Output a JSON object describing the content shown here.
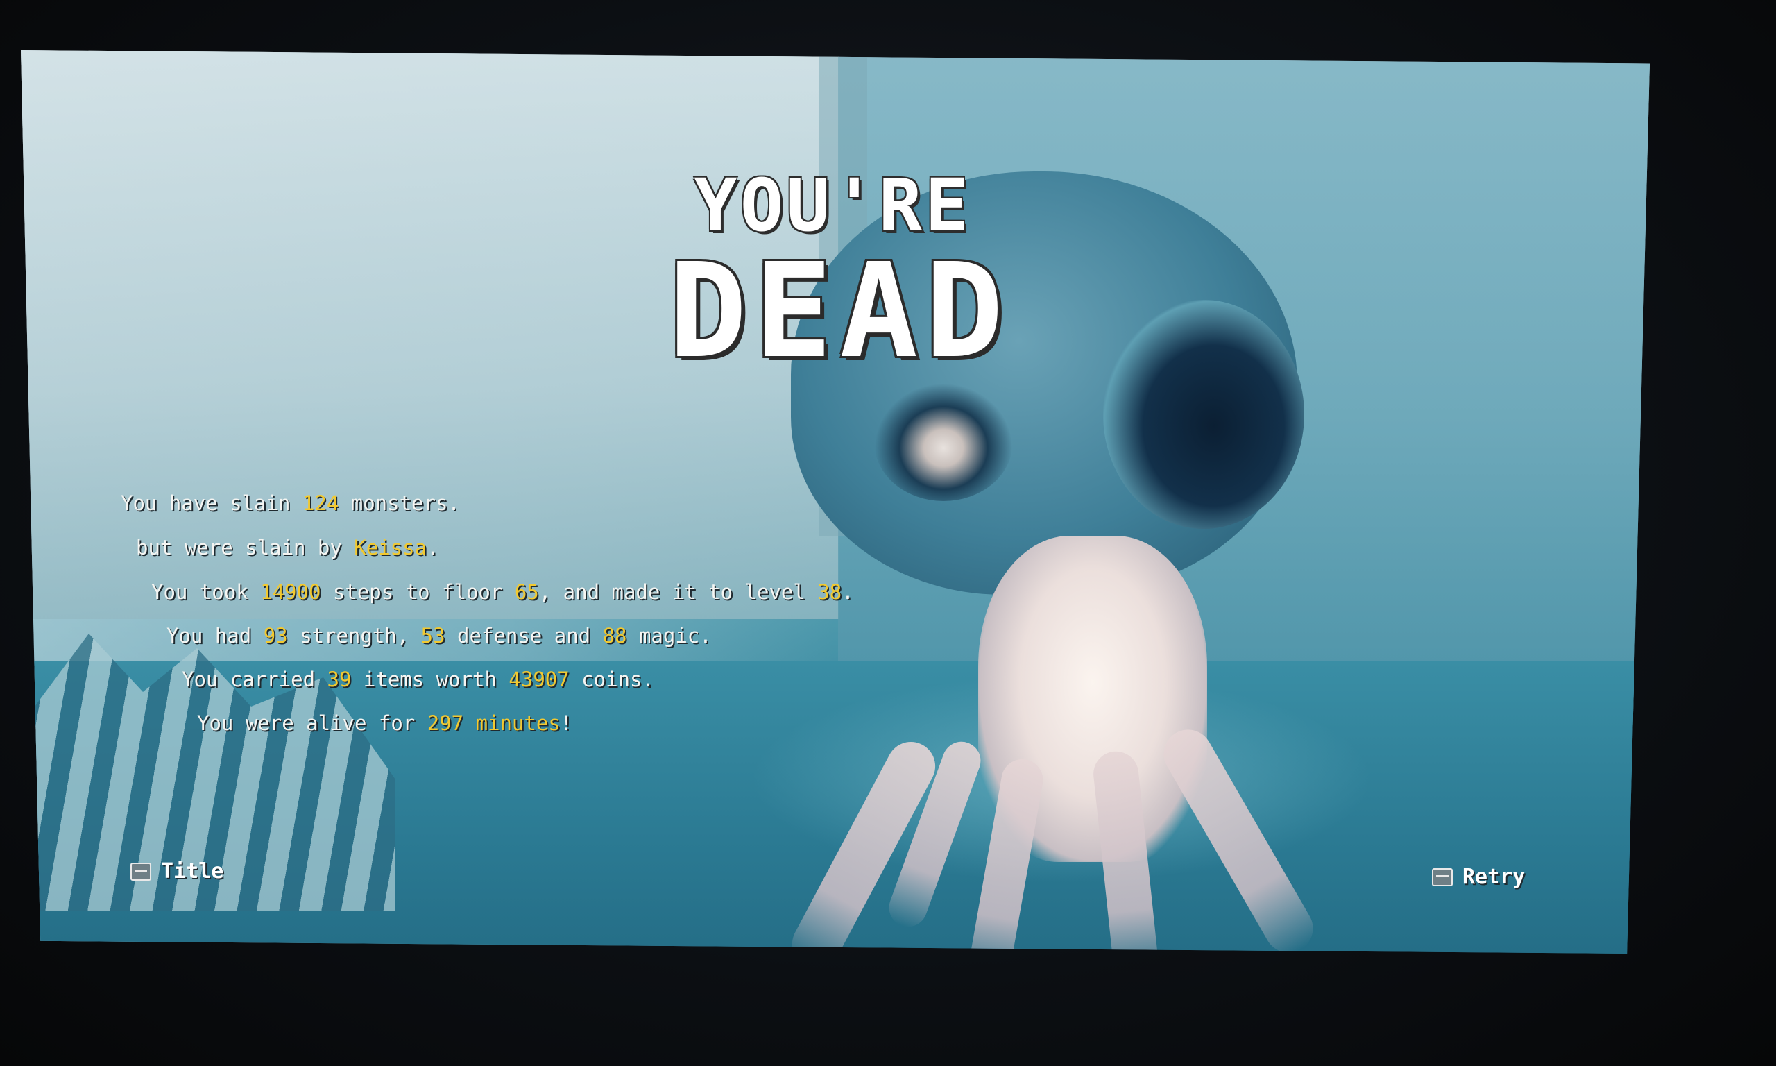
{
  "header": {
    "title_top": "YOU'RE",
    "title_main": "DEAD"
  },
  "stats": [
    [
      {
        "t": "You have slain ",
        "h": false
      },
      {
        "t": "124",
        "h": true
      },
      {
        "t": " monsters.",
        "h": false
      }
    ],
    [
      {
        "t": "but were slain by ",
        "h": false
      },
      {
        "t": "Keissa",
        "h": true
      },
      {
        "t": ".",
        "h": false
      }
    ],
    [
      {
        "t": "You took ",
        "h": false
      },
      {
        "t": "14900",
        "h": true
      },
      {
        "t": " steps to floor ",
        "h": false
      },
      {
        "t": "65",
        "h": true
      },
      {
        "t": ", and made it to level ",
        "h": false
      },
      {
        "t": "38",
        "h": true
      },
      {
        "t": ".",
        "h": false
      }
    ],
    [
      {
        "t": "You had ",
        "h": false
      },
      {
        "t": "93",
        "h": true
      },
      {
        "t": " strength, ",
        "h": false
      },
      {
        "t": "53",
        "h": true
      },
      {
        "t": " defense and ",
        "h": false
      },
      {
        "t": "88",
        "h": true
      },
      {
        "t": " magic.",
        "h": false
      }
    ],
    [
      {
        "t": "You carried ",
        "h": false
      },
      {
        "t": "39",
        "h": true
      },
      {
        "t": " items worth ",
        "h": false
      },
      {
        "t": "43907",
        "h": true
      },
      {
        "t": " coins.",
        "h": false
      }
    ],
    [
      {
        "t": "You were alive for ",
        "h": false
      },
      {
        "t": "297 minutes",
        "h": true
      },
      {
        "t": "!",
        "h": false
      }
    ]
  ],
  "buttons": {
    "title_label": "Title",
    "title_key_icon": "esc-key-icon",
    "retry_label": "Retry",
    "retry_key_icon": "tab-key-icon"
  },
  "colors": {
    "highlight": "#f2c930",
    "text": "#f5f5f2"
  }
}
